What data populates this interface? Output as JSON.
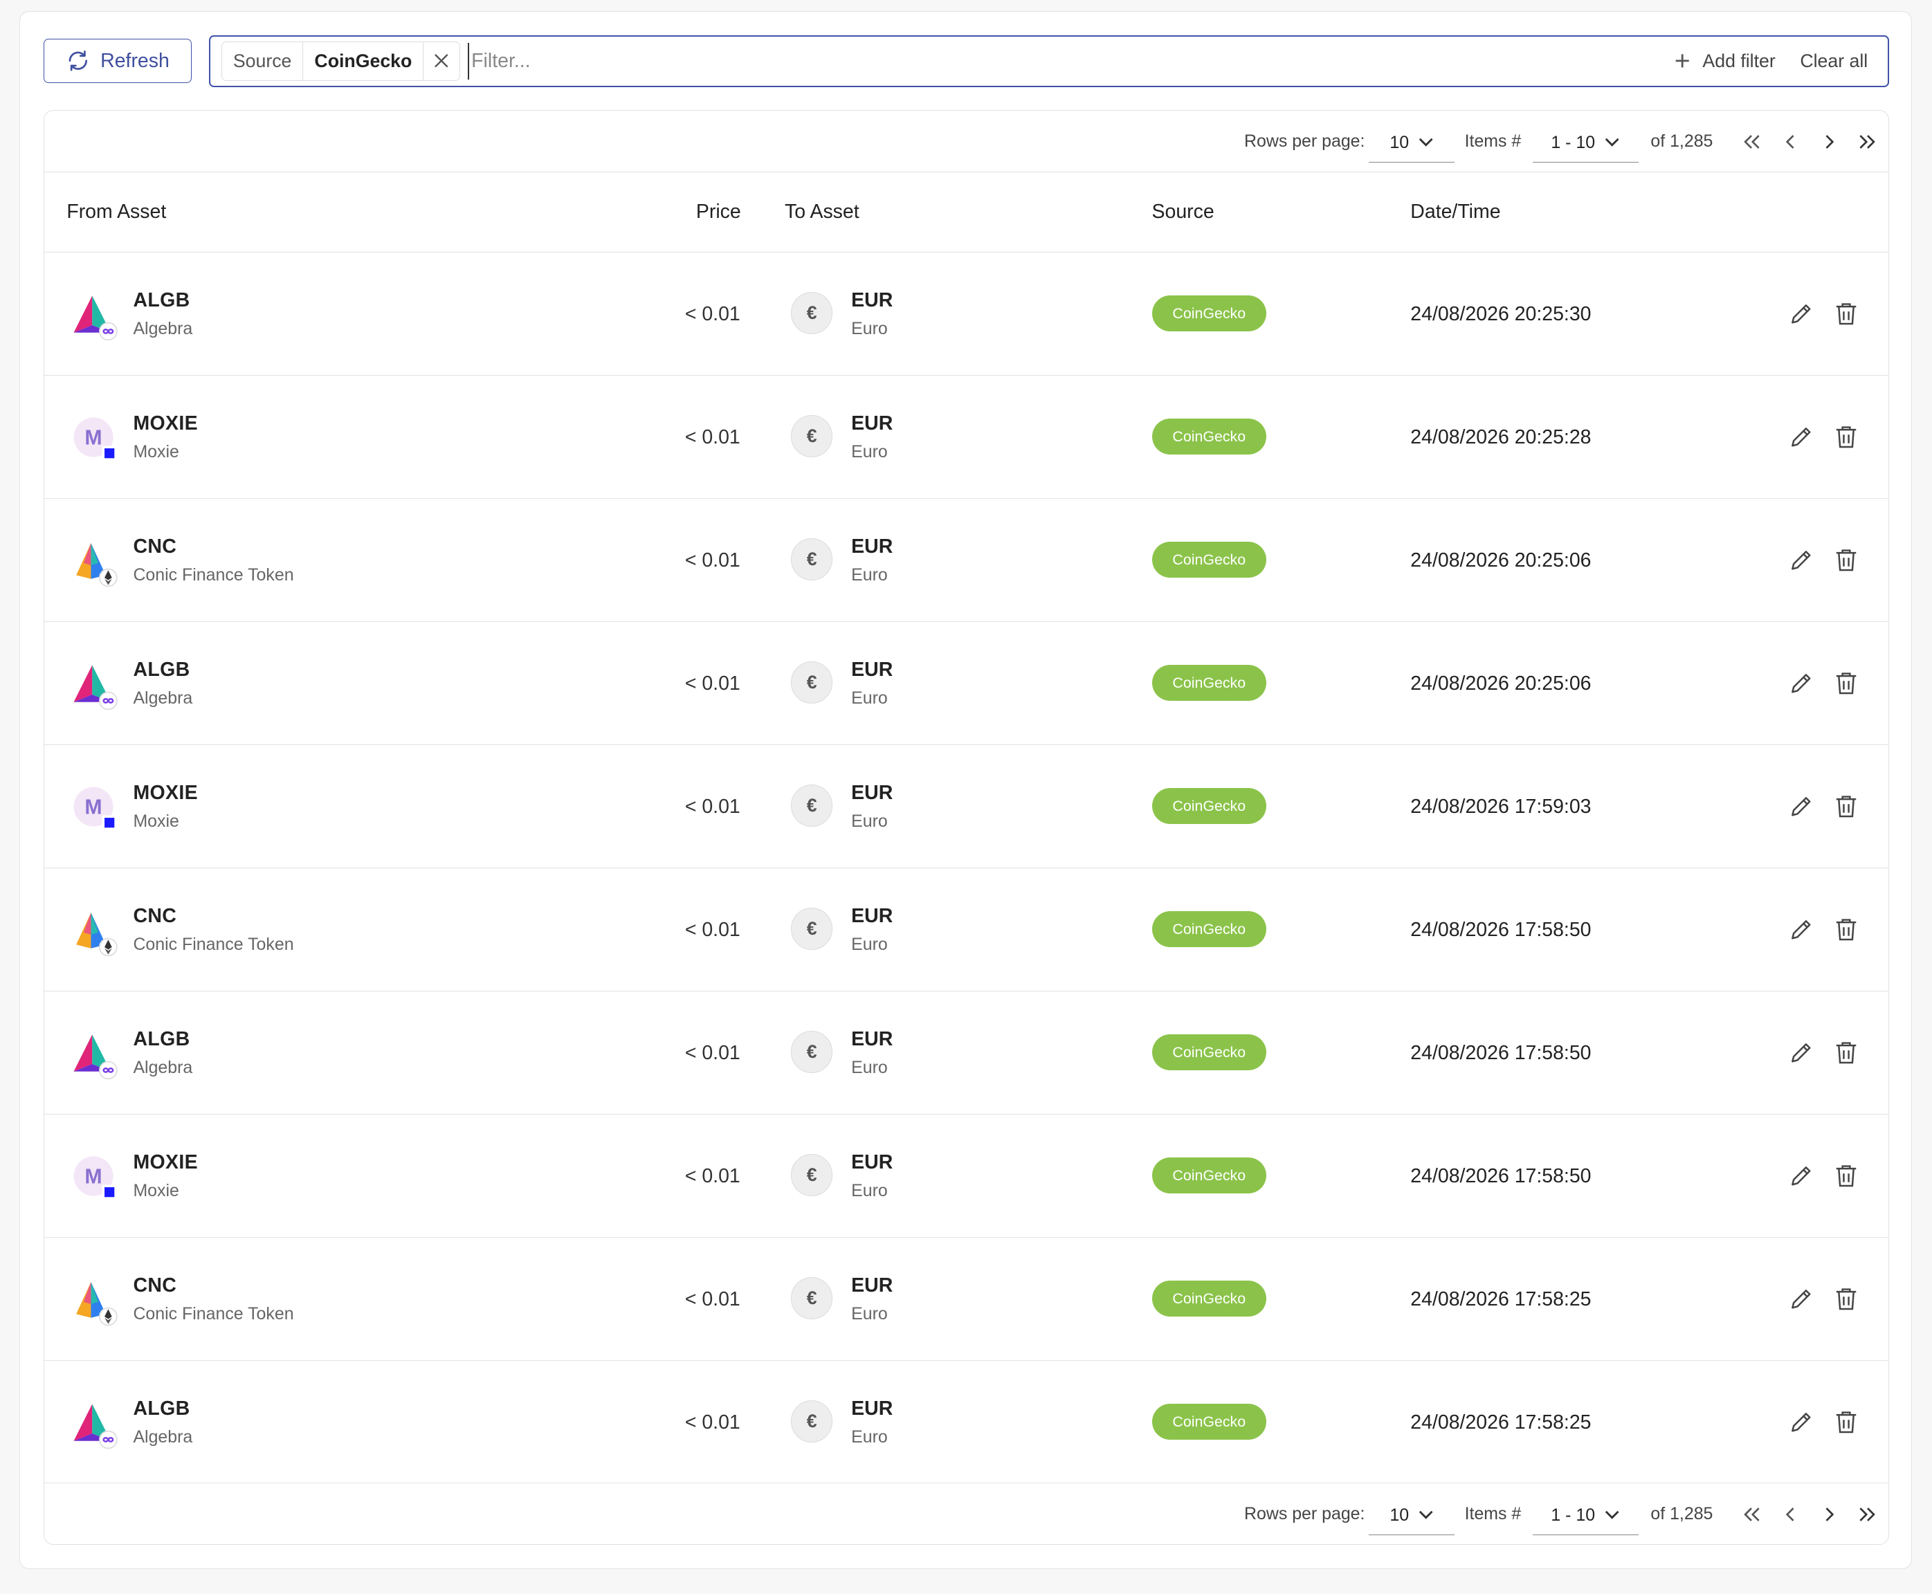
{
  "toolbar": {
    "refresh_label": "Refresh"
  },
  "filter": {
    "chip_key": "Source",
    "chip_value": "CoinGecko",
    "placeholder": "Filter...",
    "add_filter_label": "Add filter",
    "clear_all_label": "Clear all"
  },
  "pagination": {
    "rows_per_page_label": "Rows per page:",
    "rows_per_page_value": "10",
    "items_label": "Items #",
    "items_range": "1 - 10",
    "total": "of 1,285"
  },
  "table": {
    "columns": [
      "From Asset",
      "Price",
      "To Asset",
      "Source",
      "Date/Time"
    ],
    "rows": [
      {
        "from_symbol": "ALGB",
        "from_name": "Algebra",
        "from_icon": "algebra-icon",
        "price": "< 0.01",
        "to_symbol": "EUR",
        "to_name": "Euro",
        "source": "CoinGecko",
        "datetime": "24/08/2026 20:25:30"
      },
      {
        "from_symbol": "MOXIE",
        "from_name": "Moxie",
        "from_icon": "moxie-icon",
        "price": "< 0.01",
        "to_symbol": "EUR",
        "to_name": "Euro",
        "source": "CoinGecko",
        "datetime": "24/08/2026 20:25:28"
      },
      {
        "from_symbol": "CNC",
        "from_name": "Conic Finance Token",
        "from_icon": "conic-icon",
        "price": "< 0.01",
        "to_symbol": "EUR",
        "to_name": "Euro",
        "source": "CoinGecko",
        "datetime": "24/08/2026 20:25:06"
      },
      {
        "from_symbol": "ALGB",
        "from_name": "Algebra",
        "from_icon": "algebra-icon",
        "price": "< 0.01",
        "to_symbol": "EUR",
        "to_name": "Euro",
        "source": "CoinGecko",
        "datetime": "24/08/2026 20:25:06"
      },
      {
        "from_symbol": "MOXIE",
        "from_name": "Moxie",
        "from_icon": "moxie-icon",
        "price": "< 0.01",
        "to_symbol": "EUR",
        "to_name": "Euro",
        "source": "CoinGecko",
        "datetime": "24/08/2026 17:59:03"
      },
      {
        "from_symbol": "CNC",
        "from_name": "Conic Finance Token",
        "from_icon": "conic-icon",
        "price": "< 0.01",
        "to_symbol": "EUR",
        "to_name": "Euro",
        "source": "CoinGecko",
        "datetime": "24/08/2026 17:58:50"
      },
      {
        "from_symbol": "ALGB",
        "from_name": "Algebra",
        "from_icon": "algebra-icon",
        "price": "< 0.01",
        "to_symbol": "EUR",
        "to_name": "Euro",
        "source": "CoinGecko",
        "datetime": "24/08/2026 17:58:50"
      },
      {
        "from_symbol": "MOXIE",
        "from_name": "Moxie",
        "from_icon": "moxie-icon",
        "price": "< 0.01",
        "to_symbol": "EUR",
        "to_name": "Euro",
        "source": "CoinGecko",
        "datetime": "24/08/2026 17:58:50"
      },
      {
        "from_symbol": "CNC",
        "from_name": "Conic Finance Token",
        "from_icon": "conic-icon",
        "price": "< 0.01",
        "to_symbol": "EUR",
        "to_name": "Euro",
        "source": "CoinGecko",
        "datetime": "24/08/2026 17:58:25"
      },
      {
        "from_symbol": "ALGB",
        "from_name": "Algebra",
        "from_icon": "algebra-icon",
        "price": "< 0.01",
        "to_symbol": "EUR",
        "to_name": "Euro",
        "source": "CoinGecko",
        "datetime": "24/08/2026 17:58:25"
      }
    ]
  },
  "colors": {
    "accent": "#3f51a8",
    "source_badge": "#8bc34a"
  }
}
